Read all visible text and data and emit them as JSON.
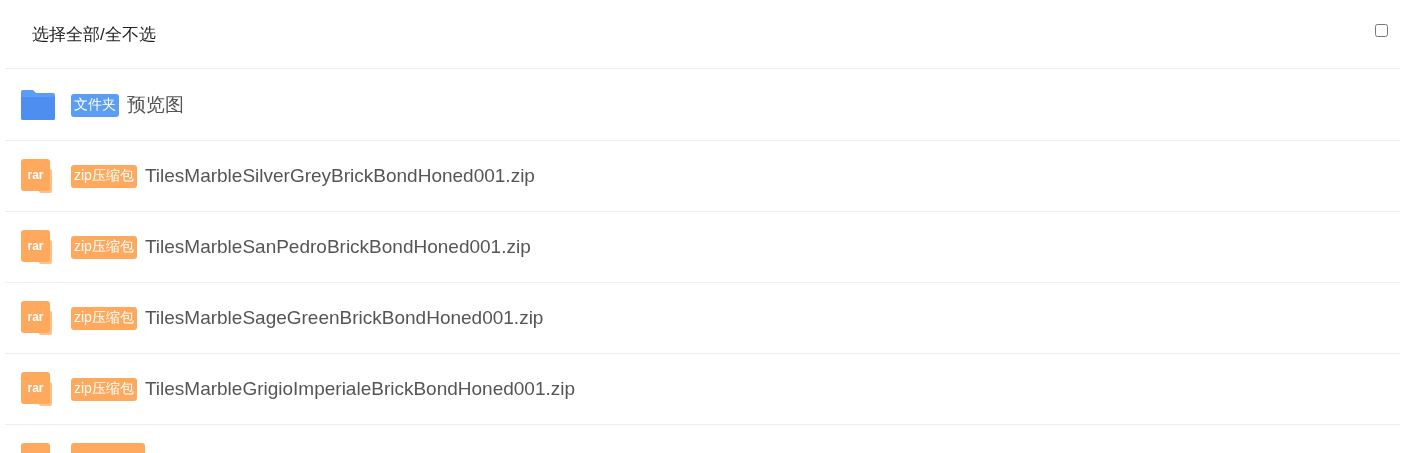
{
  "header": {
    "label": "选择全部/全不选",
    "checked": false
  },
  "files": [
    {
      "kind": "folder",
      "tag": "文件夹",
      "name": "预览图"
    },
    {
      "kind": "archive",
      "icon_text": "rar",
      "tag": "zip压缩包",
      "name": "TilesMarbleSilverGreyBrickBondHoned001.zip"
    },
    {
      "kind": "archive",
      "icon_text": "rar",
      "tag": "zip压缩包",
      "name": "TilesMarbleSanPedroBrickBondHoned001.zip"
    },
    {
      "kind": "archive",
      "icon_text": "rar",
      "tag": "zip压缩包",
      "name": "TilesMarbleSageGreenBrickBondHoned001.zip"
    },
    {
      "kind": "archive",
      "icon_text": "rar",
      "tag": "zip压缩包",
      "name": "TilesMarbleGrigioImperialeBrickBondHoned001.zip"
    },
    {
      "kind": "archive_cut"
    }
  ]
}
